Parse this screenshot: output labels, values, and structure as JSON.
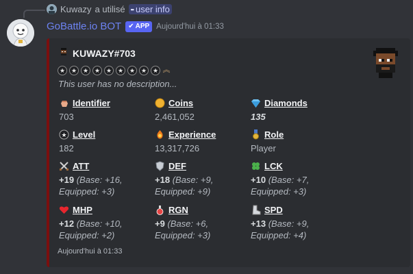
{
  "reply": {
    "user": "Kuwazy",
    "action": "a utilisé",
    "command": "user info"
  },
  "message": {
    "bot_name": "GoBattle.io BOT",
    "app_badge": "APP",
    "timestamp": "Aujourd'hui à 01:33"
  },
  "embed": {
    "color": "#7a0f0f",
    "author": "KUWAZY#703",
    "star_count": 9,
    "description": "This user has no description...",
    "footer": "Aujourd'hui à 01:33",
    "fields": [
      {
        "key": "identifier",
        "icon": "hand-icon",
        "name": "Identifier",
        "value": "703"
      },
      {
        "key": "coins",
        "icon": "coin-icon",
        "name": "Coins",
        "value": "2,461,052"
      },
      {
        "key": "diamonds",
        "icon": "diamond-icon",
        "name": "Diamonds",
        "value": "135"
      },
      {
        "key": "level",
        "icon": "star-badge-icon",
        "name": "Level",
        "value": "182"
      },
      {
        "key": "experience",
        "icon": "flame-gem-icon",
        "name": "Experience",
        "value": "13,317,726"
      },
      {
        "key": "role",
        "icon": "medal-icon",
        "name": "Role",
        "value": "Player"
      },
      {
        "key": "att",
        "icon": "crossed-swords-icon",
        "name": "ATT",
        "bonus": "+19",
        "detail1": "(Base: +16,",
        "detail2": "Equipped: +3)"
      },
      {
        "key": "def",
        "icon": "shield-icon",
        "name": "DEF",
        "bonus": "+18",
        "detail1": "(Base: +9,",
        "detail2": "Equipped: +9)"
      },
      {
        "key": "lck",
        "icon": "clover-icon",
        "name": "LCK",
        "bonus": "+10",
        "detail1": "(Base: +7,",
        "detail2": "Equipped: +3)"
      },
      {
        "key": "mhp",
        "icon": "heart-icon",
        "name": "MHP",
        "bonus": "+12",
        "detail1": "(Base: +10,",
        "detail2": "Equipped: +2)"
      },
      {
        "key": "rgn",
        "icon": "potion-icon",
        "name": "RGN",
        "bonus": "+9",
        "detail1": "(Base: +6,",
        "detail2": "Equipped: +3)"
      },
      {
        "key": "spd",
        "icon": "boot-icon",
        "name": "SPD",
        "bonus": "+13",
        "detail1": "(Base: +9,",
        "detail2": "Equipped: +4)"
      }
    ]
  },
  "colors": {
    "background": "#313338",
    "embed_bg": "#2b2d31",
    "bot_name": "#6d83f2",
    "app_badge": "#5865f2"
  }
}
